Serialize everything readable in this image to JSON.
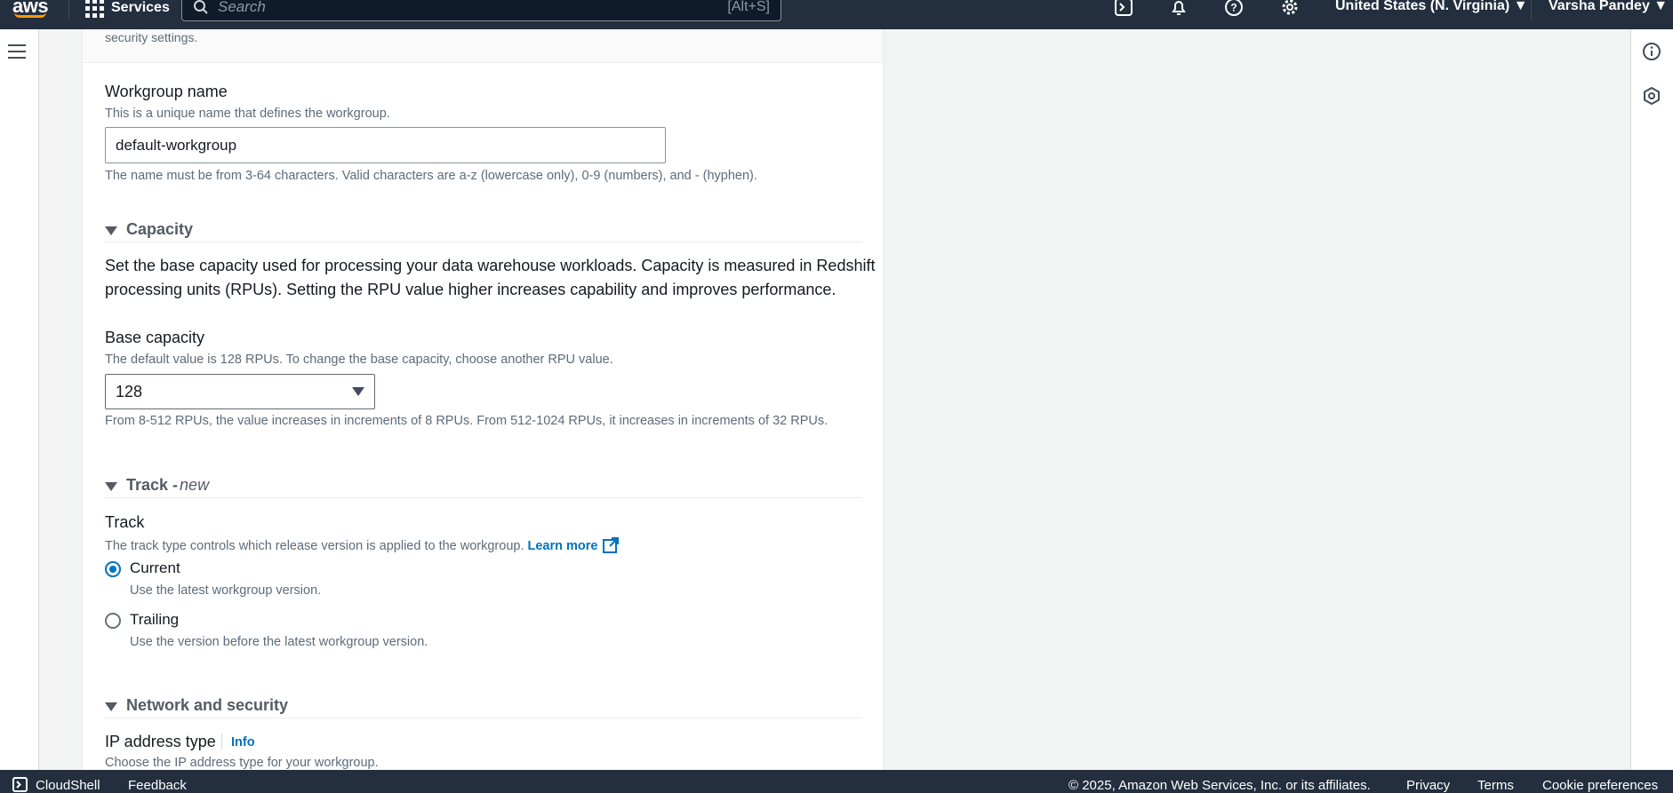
{
  "nav": {
    "logo": "aws",
    "services_label": "Services",
    "search_placeholder": "Search",
    "search_shortcut": "[Alt+S]",
    "region": "United States (N. Virginia) ▼",
    "user": "Varsha Pandey ▼"
  },
  "panel_header": {
    "text": "security settings."
  },
  "workgroup": {
    "label": "Workgroup name",
    "description": "This is a unique name that defines the workgroup.",
    "value": "default-workgroup",
    "constraint": "The name must be from 3-64 characters. Valid characters are a-z (lowercase only), 0-9 (numbers), and - (hyphen)."
  },
  "capacity": {
    "section_title": "Capacity",
    "body_line1": "Set the base capacity used for processing your data warehouse workloads. Capacity is measured in Redshift",
    "body_line2": "processing units (RPUs). Setting the RPU value higher increases capability and improves performance.",
    "base_label": "Base capacity",
    "base_description": "The default value is 128 RPUs. To change the base capacity, choose another RPU value.",
    "base_value": "128",
    "base_constraint": "From 8-512 RPUs, the value increases in increments of 8 RPUs. From 512-1024 RPUs, it increases in increments of 32 RPUs."
  },
  "track": {
    "section_title": "Track -",
    "section_title_tag": "new",
    "label": "Track",
    "description": "The track type controls which release version is applied to the workgroup.",
    "learn_more": "Learn more",
    "options": [
      {
        "label": "Current",
        "description": "Use the latest workgroup version.",
        "selected": true
      },
      {
        "label": "Trailing",
        "description": "Use the version before the latest workgroup version.",
        "selected": false
      }
    ]
  },
  "network": {
    "section_title": "Network and security",
    "ip_label": "IP address type",
    "info_link": "Info",
    "ip_description": "Choose the IP address type for your workgroup."
  },
  "footer": {
    "cloudshell": "CloudShell",
    "feedback": "Feedback",
    "copyright": "© 2025, Amazon Web Services, Inc. or its affiliates.",
    "privacy": "Privacy",
    "terms": "Terms",
    "cookies": "Cookie preferences"
  },
  "colors": {
    "nav_bg": "#232f3e",
    "accent": "#0073bb",
    "brand_orange": "#ff9900"
  }
}
